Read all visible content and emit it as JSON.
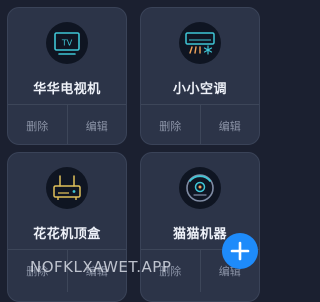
{
  "devices": [
    {
      "name": "华华电视机",
      "icon": "tv-icon",
      "delete_label": "删除",
      "edit_label": "编辑"
    },
    {
      "name": "小小空调",
      "icon": "air-conditioner-icon",
      "delete_label": "删除",
      "edit_label": "编辑"
    },
    {
      "name": "花花机顶盒",
      "icon": "router-box-icon",
      "delete_label": "删除",
      "edit_label": "编辑"
    },
    {
      "name": "猫猫机器",
      "icon": "robot-vacuum-icon",
      "delete_label": "删除",
      "edit_label": "编辑"
    }
  ],
  "tv_icon_text": "TV",
  "watermark": "NOFKLXAWET.APP",
  "fab_icon": "plus-icon",
  "colors": {
    "background": "#1b2030",
    "card": "#2c3448",
    "accent_cyan": "#3fc6d6",
    "accent_yellow": "#e1c15a",
    "accent_orange": "#f0a35a",
    "fab": "#1e8bfa"
  }
}
